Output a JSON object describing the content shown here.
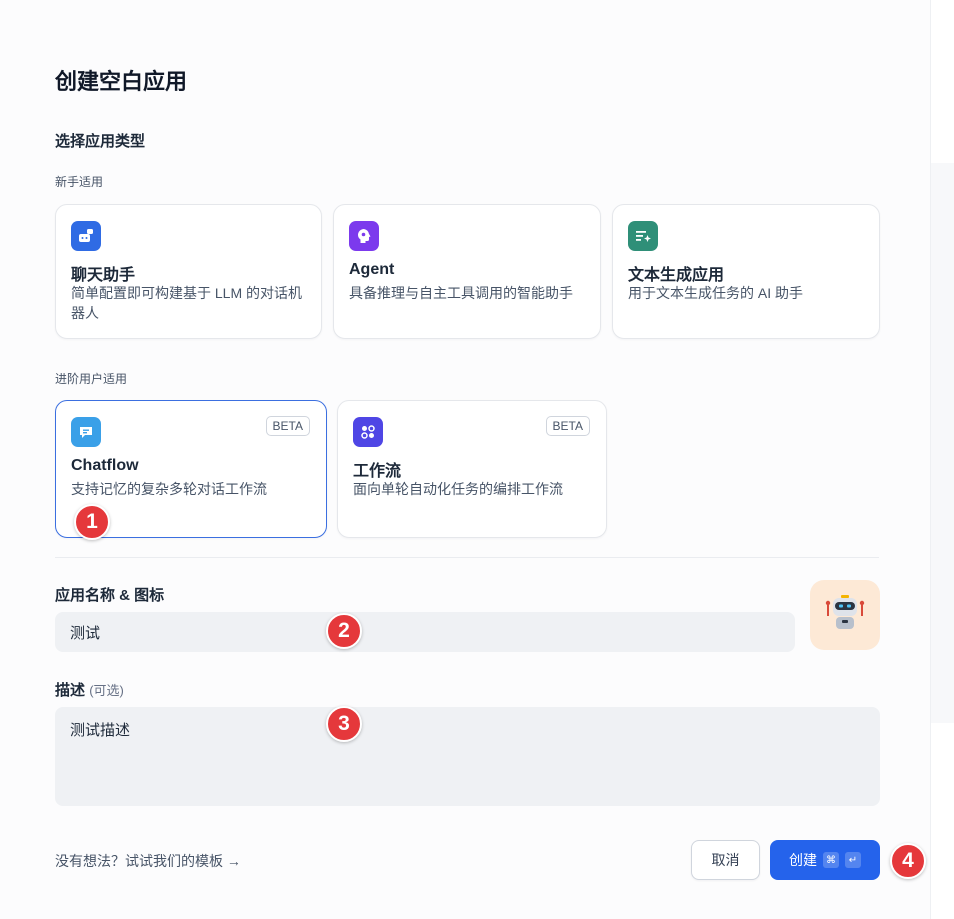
{
  "dialog": {
    "title": "创建空白应用"
  },
  "app_type": {
    "section_title": "选择应用类型",
    "beginner": {
      "label": "新手适用",
      "cards": [
        {
          "title": "聊天助手",
          "desc": "简单配置即可构建基于 LLM 的对话机器人",
          "icon": "chatbot-icon",
          "icon_color": "#2f6be4"
        },
        {
          "title": "Agent",
          "desc": "具备推理与自主工具调用的智能助手",
          "icon": "agent-icon",
          "icon_color": "#7c3aed"
        },
        {
          "title": "文本生成应用",
          "desc": "用于文本生成任务的 AI 助手",
          "icon": "text-generator-icon",
          "icon_color": "#2f8f78"
        }
      ]
    },
    "advanced": {
      "label": "进阶用户适用",
      "cards": [
        {
          "title": "Chatflow",
          "desc": "支持记忆的复杂多轮对话工作流",
          "badge": "BETA",
          "icon": "chatflow-icon",
          "icon_color": "#3aa0e8",
          "selected": true
        },
        {
          "title": "工作流",
          "desc": "面向单轮自动化任务的编排工作流",
          "badge": "BETA",
          "icon": "workflow-icon",
          "icon_color": "#4f46e5",
          "selected": false
        }
      ]
    }
  },
  "name_section": {
    "label": "应用名称 & 图标",
    "value": "测试",
    "avatar_icon": "robot-icon",
    "avatar_bg": "#fde9d6"
  },
  "description_section": {
    "label": "描述",
    "optional": "(可选)",
    "value": "测试描述"
  },
  "footer": {
    "template_link": "没有想法？试试我们的模板 →",
    "cancel_label": "取消",
    "create_label": "创建",
    "create_shortcut_1": "⌘",
    "create_shortcut_2": "↵"
  },
  "markers": [
    "1",
    "2",
    "3",
    "4"
  ],
  "colors": {
    "primary": "#2563eb",
    "selected_border": "#3b6fe0",
    "marker": "#e5383b"
  }
}
